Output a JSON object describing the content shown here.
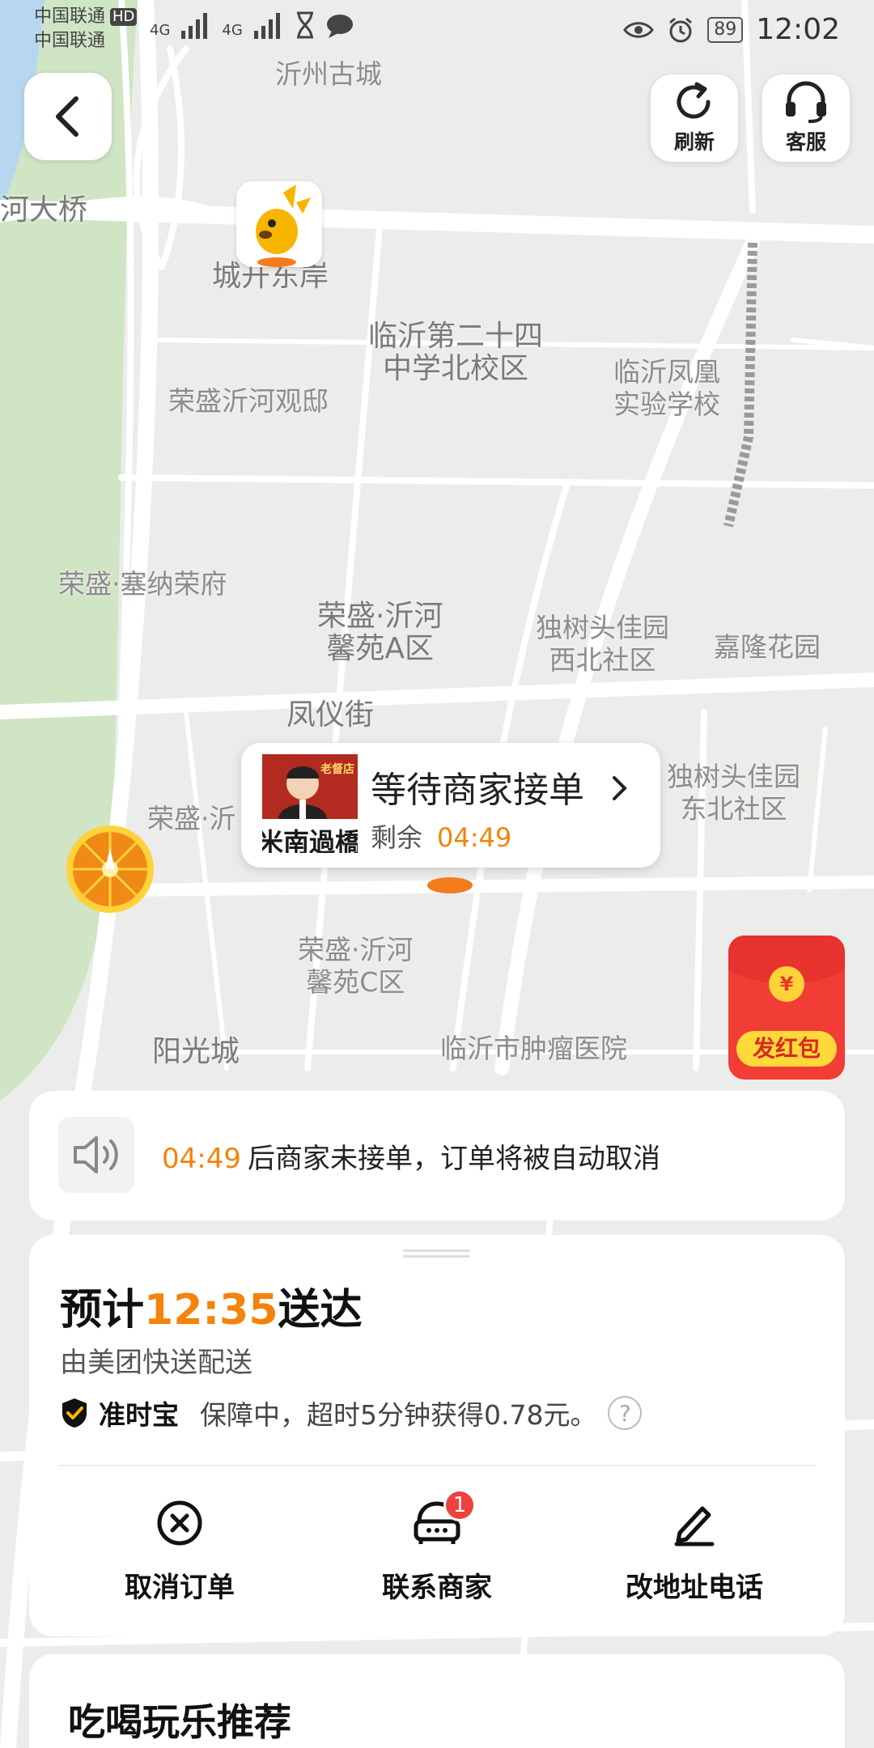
{
  "status_bar": {
    "carrier_1": "中国联通",
    "carrier_2": "中国联通",
    "hd": "HD",
    "network_1": "4G",
    "network_2": "4G",
    "battery": "89",
    "time": "12:02"
  },
  "top_buttons": {
    "refresh_label": "刷新",
    "service_label": "客服"
  },
  "map_labels": {
    "l1": "沂州古城",
    "l2": "河大桥",
    "l3": "城开东岸",
    "l4": "临沂第二十四\n中学北校区",
    "l5": "荣盛沂河观邸",
    "l6": "临沂凤凰\n实验学校",
    "l7": "荣盛·塞纳荣府",
    "l8": "荣盛·沂河\n馨苑A区",
    "l9": "独树头佳园\n西北社区",
    "l10": "嘉隆花园",
    "l11": "凤仪街",
    "l12": "独树头佳园\n东北社区",
    "l13": "荣盛·沂",
    "l14": "荣盛·沂河\n馨苑C区",
    "l15": "阳光城",
    "l16": "临沂市肿瘤医院"
  },
  "merchant_popup": {
    "status": "等待商家接单",
    "remaining_label": "剩余",
    "remaining_time": "04:49",
    "shop_sign": "米南過橋",
    "shop_badge": "老督店"
  },
  "notice": {
    "time": "04:49",
    "text": "后商家未接单，订单将被自动取消"
  },
  "delivery": {
    "eta_prefix": "预计",
    "eta_time": "12:35",
    "eta_suffix": "送达",
    "carrier": "由美团快送配送",
    "guarantee_name": "准时宝",
    "guarantee_text": "保障中，超时5分钟获得0.78元。",
    "help_symbol": "?"
  },
  "actions": {
    "cancel_label": "取消订单",
    "contact_label": "联系商家",
    "contact_badge": "1",
    "edit_label": "改地址电话"
  },
  "red_packet": {
    "coin": "¥",
    "label": "发红包"
  },
  "recommend": {
    "title": "吃喝玩乐推荐"
  },
  "colors": {
    "accent": "#f5820a",
    "badge": "#f0413c",
    "red_packet": "#f23c36"
  }
}
